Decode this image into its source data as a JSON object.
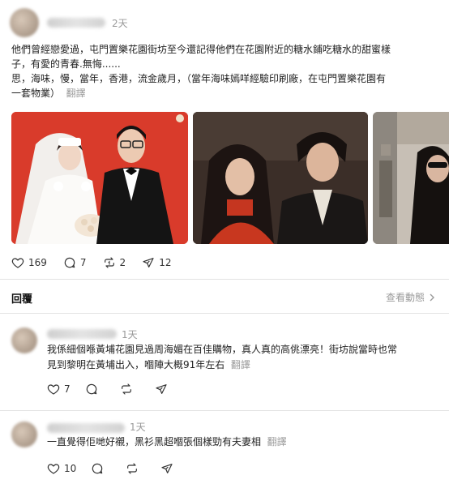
{
  "post": {
    "time": "2天",
    "body_line1": "他們曾經戀愛過，屯門置樂花園街坊至今還記得他們在花園附近的糖水鋪吃糖水的甜蜜樣",
    "body_line2": "子，有愛的青春.無悔......",
    "body_line3": "思，海味，慢，當年，香港，流金歲月，（當年海味嫣咩經驗印刷廠，在屯門置樂花園有",
    "body_line4": "一套物業）",
    "translate": "翻譯",
    "likes": "169",
    "comments": "7",
    "reposts": "2",
    "shares": "12"
  },
  "replies_section": {
    "title": "回覆",
    "view_activity": "查看動態"
  },
  "comments": [
    {
      "time": "1天",
      "line1": "我係細個喺黃埔花園見過周海媚在百佳購物，真人真的高佻漂亮！街坊說當時也常",
      "line2": "見到黎明在黃埔出入，嗰陣大概91年左右",
      "translate": "翻譯",
      "likes": "7"
    },
    {
      "time": "1天",
      "line1": "一直覺得佢哋好襯，黑衫黑超嗰張個樣勁有夫妻相",
      "translate": "翻譯",
      "likes": "10"
    }
  ],
  "icons": {
    "like": "heart-icon",
    "comment": "comment-bubble-icon",
    "repost": "repost-icon",
    "share": "send-icon"
  }
}
